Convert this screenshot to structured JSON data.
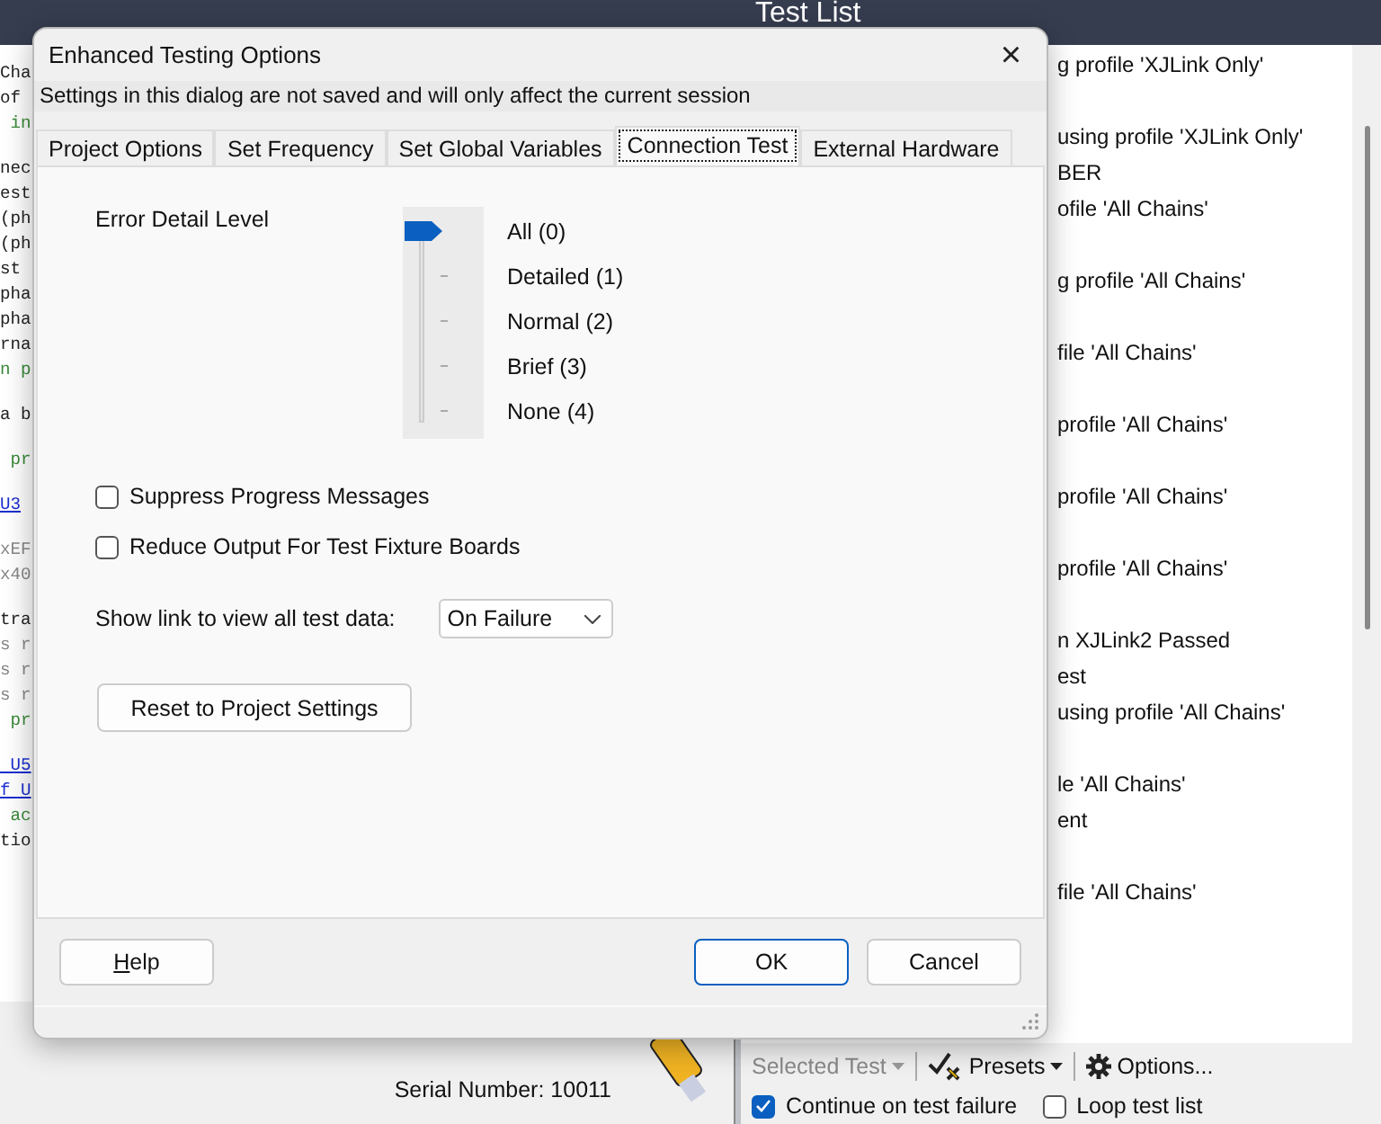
{
  "editor": {
    "blocks": [
      [
        {
          "text": "Cha",
          "kind": "plain"
        },
        {
          "text": "of",
          "kind": "plain"
        },
        {
          "text": " in",
          "kind": "code"
        }
      ],
      [
        {
          "text": "nec",
          "kind": "plain"
        },
        {
          "text": "est",
          "kind": "plain"
        },
        {
          "text": "(ph",
          "kind": "plain"
        },
        {
          "text": "(ph",
          "kind": "plain"
        },
        {
          "text": "st",
          "kind": "plain"
        },
        {
          "text": "pha",
          "kind": "plain"
        },
        {
          "text": "pha",
          "kind": "plain"
        },
        {
          "text": "rna",
          "kind": "plain"
        },
        {
          "text": "n p",
          "kind": "code"
        }
      ],
      [
        {
          "text": "a b",
          "kind": "plain"
        }
      ],
      [
        {
          "text": " pr",
          "kind": "code"
        }
      ],
      [
        {
          "text": "U3",
          "kind": "link"
        }
      ],
      [
        {
          "text": "xEF",
          "kind": "dim"
        },
        {
          "text": "x40",
          "kind": "dim"
        }
      ],
      [
        {
          "text": "tra",
          "kind": "plain"
        },
        {
          "text": "s r",
          "kind": "dim"
        },
        {
          "text": "s r",
          "kind": "dim"
        },
        {
          "text": "s r",
          "kind": "dim"
        },
        {
          "text": " pr",
          "kind": "code"
        }
      ],
      [
        {
          "text": " U5",
          "kind": "link"
        },
        {
          "text": "f U",
          "kind": "link"
        },
        {
          "text": " ac",
          "kind": "code"
        },
        {
          "text": "tio",
          "kind": "plain"
        }
      ]
    ]
  },
  "test_list": {
    "title": "Test List",
    "blocks": [
      [
        "g profile 'XJLink Only'"
      ],
      [
        "using profile 'XJLink Only'",
        "BER",
        "ofile 'All Chains'"
      ],
      [
        "g profile 'All Chains'"
      ],
      [
        "file 'All Chains'"
      ],
      [
        "profile 'All Chains'"
      ],
      [
        "profile 'All Chains'"
      ],
      [
        "profile 'All Chains'"
      ],
      [
        "n XJLink2 Passed",
        "est",
        "using profile 'All Chains'"
      ],
      [
        "le 'All Chains'",
        "ent"
      ],
      [
        "file 'All Chains'"
      ]
    ]
  },
  "status": {
    "serial": "Serial Number: 10011"
  },
  "toolbar": {
    "items": [
      {
        "label": "Selected Test",
        "kind": "dropdown",
        "disabled": true
      },
      {
        "label": "Presets",
        "kind": "presets",
        "disabled": false
      },
      {
        "label": "Options...",
        "kind": "options",
        "disabled": false
      }
    ],
    "checks": [
      {
        "label": "Continue on test failure",
        "checked": true
      },
      {
        "label": "Loop test list",
        "checked": false
      }
    ]
  },
  "dialog": {
    "title": "Enhanced Testing Options",
    "close": "×",
    "notice": "Settings in this dialog are not saved and will only affect the current session",
    "tabs": [
      {
        "label": "Project Options",
        "selected": false
      },
      {
        "label": "Set Frequency",
        "selected": false
      },
      {
        "label": "Set Global Variables",
        "selected": false
      },
      {
        "label": "Connection Test",
        "selected": true
      },
      {
        "label": "External Hardware",
        "selected": false
      }
    ],
    "error_detail": {
      "label": "Error Detail Level",
      "options": [
        {
          "label": "All (0)",
          "selected": true
        },
        {
          "label": "Detailed (1)",
          "selected": false
        },
        {
          "label": "Normal (2)",
          "selected": false
        },
        {
          "label": "Brief (3)",
          "selected": false
        },
        {
          "label": "None (4)",
          "selected": false
        }
      ]
    },
    "checkboxes": [
      {
        "label": "Suppress Progress Messages",
        "checked": false
      },
      {
        "label": "Reduce Output For Test Fixture Boards",
        "checked": false
      }
    ],
    "link_option": {
      "label": "Show link to view all test data:",
      "value": "On Failure"
    },
    "reset_button": "Reset to Project Settings",
    "buttons": [
      {
        "label": "Help",
        "kind": "help"
      },
      {
        "label": "OK",
        "kind": "default"
      },
      {
        "label": "Cancel",
        "kind": "normal"
      }
    ]
  }
}
